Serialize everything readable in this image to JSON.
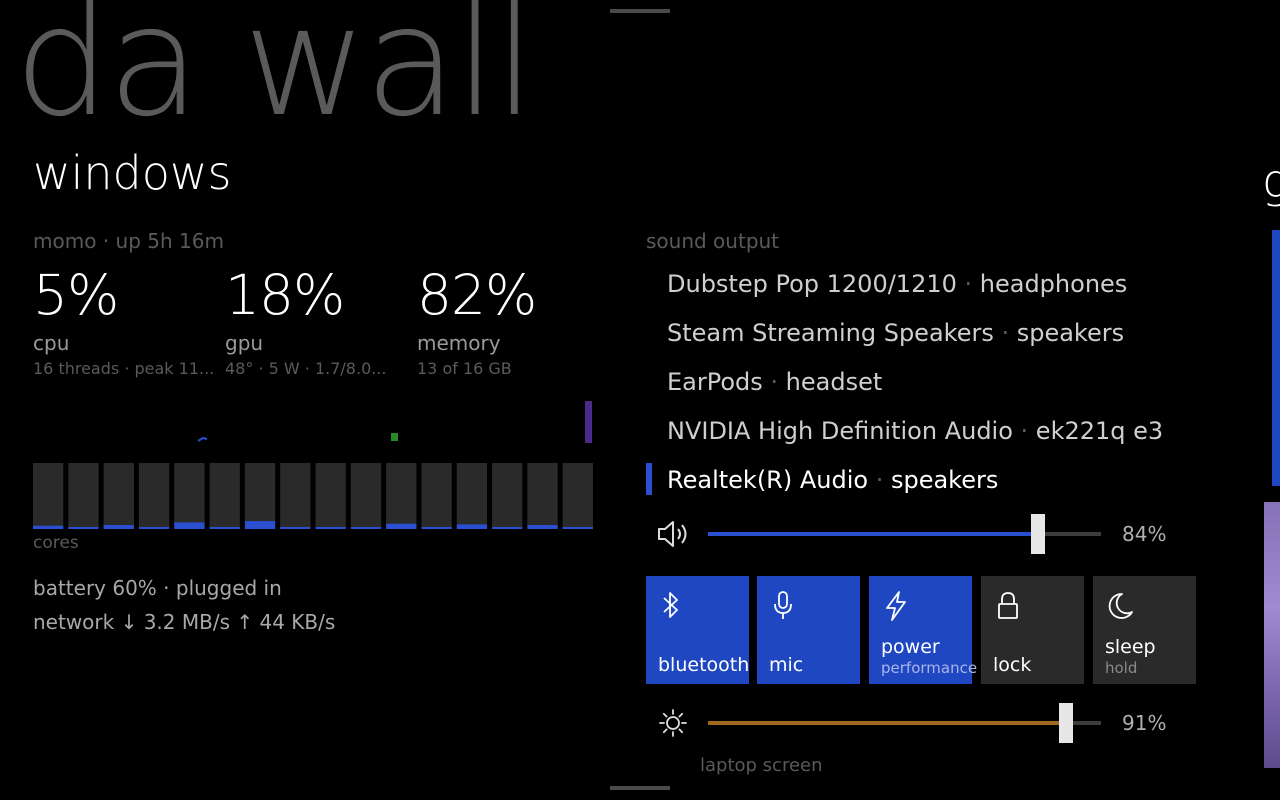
{
  "hub": {
    "title": "da wall",
    "section": "windows",
    "peek_letter": "g"
  },
  "system": {
    "host": "momo",
    "uptime": "up 5h 16m",
    "stats": [
      {
        "id": "cpu",
        "value": "5%",
        "label": "cpu",
        "sub": "16 threads  ·  peak 11..."
      },
      {
        "id": "gpu",
        "value": "18%",
        "label": "gpu",
        "sub": "48°  ·  5 W  ·  1.7/8.0..."
      },
      {
        "id": "memory",
        "value": "82%",
        "label": "memory",
        "sub": "13 of 16 GB"
      }
    ],
    "cores_label": "cores",
    "core_loads": [
      0.05,
      0.03,
      0.06,
      0.03,
      0.1,
      0.03,
      0.12,
      0.03,
      0.03,
      0.03,
      0.08,
      0.03,
      0.07,
      0.03,
      0.06,
      0.03
    ],
    "battery": "battery 60%  ·  plugged in",
    "network": "network  ↓ 3.2 MB/s   ↑ 44 KB/s"
  },
  "colors": {
    "accent": "#2b4fd1",
    "tile_on": "#1f47c2",
    "brightness": "#a0681e",
    "core_bg": "#2a2a2a",
    "spark_cpu": "#2b4fd1",
    "spark_gpu": "#2a8a2a",
    "spark_mem": "#4a2a8a"
  },
  "sound": {
    "title": "sound output",
    "devices": [
      {
        "name": "Dubstep Pop 1200/1210",
        "type": "headphones",
        "selected": false
      },
      {
        "name": "Steam Streaming Speakers",
        "type": "speakers",
        "selected": false
      },
      {
        "name": "EarPods",
        "type": "headset",
        "selected": false
      },
      {
        "name": "NVIDIA High Definition Audio",
        "type": "ek221q e3",
        "selected": false
      },
      {
        "name": "Realtek(R) Audio",
        "type": "speakers",
        "selected": true
      }
    ],
    "volume": {
      "percent_label": "84%",
      "level": 0.84,
      "icon": "speaker-volume-icon"
    }
  },
  "quick_actions": [
    {
      "id": "bluetooth",
      "label": "bluetooth",
      "sub": "",
      "on": true,
      "icon": "bluetooth-icon"
    },
    {
      "id": "mic",
      "label": "mic",
      "sub": "",
      "on": true,
      "icon": "microphone-icon"
    },
    {
      "id": "power",
      "label": "power",
      "sub": "performance",
      "on": true,
      "icon": "lightning-icon"
    },
    {
      "id": "lock",
      "label": "lock",
      "sub": "",
      "on": false,
      "icon": "lock-icon"
    },
    {
      "id": "sleep",
      "label": "sleep",
      "sub": "hold",
      "on": false,
      "icon": "moon-icon"
    }
  ],
  "brightness": {
    "percent_label": "91%",
    "level": 0.91,
    "label": "laptop screen",
    "icon": "sun-icon"
  }
}
